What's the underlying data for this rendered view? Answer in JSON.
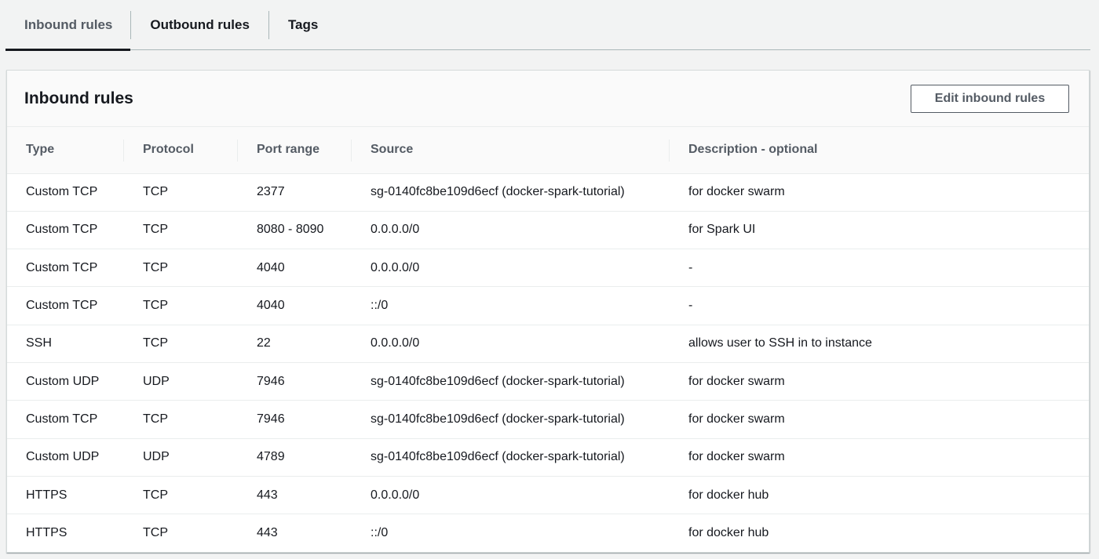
{
  "tabs": [
    {
      "label": "Inbound rules",
      "active": true
    },
    {
      "label": "Outbound rules",
      "active": false
    },
    {
      "label": "Tags",
      "active": false
    }
  ],
  "panel": {
    "title": "Inbound rules",
    "edit_button_label": "Edit inbound rules"
  },
  "table": {
    "columns": [
      "Type",
      "Protocol",
      "Port range",
      "Source",
      "Description - optional"
    ],
    "rows": [
      [
        "Custom TCP",
        "TCP",
        "2377",
        "sg-0140fc8be109d6ecf (docker-spark-tutorial)",
        "for docker swarm"
      ],
      [
        "Custom TCP",
        "TCP",
        "8080 - 8090",
        "0.0.0.0/0",
        "for Spark UI"
      ],
      [
        "Custom TCP",
        "TCP",
        "4040",
        "0.0.0.0/0",
        "-"
      ],
      [
        "Custom TCP",
        "TCP",
        "4040",
        "::/0",
        "-"
      ],
      [
        "SSH",
        "TCP",
        "22",
        "0.0.0.0/0",
        "allows user to SSH in to instance"
      ],
      [
        "Custom UDP",
        "UDP",
        "7946",
        "sg-0140fc8be109d6ecf (docker-spark-tutorial)",
        "for docker swarm"
      ],
      [
        "Custom TCP",
        "TCP",
        "7946",
        "sg-0140fc8be109d6ecf (docker-spark-tutorial)",
        "for docker swarm"
      ],
      [
        "Custom UDP",
        "UDP",
        "4789",
        "sg-0140fc8be109d6ecf (docker-spark-tutorial)",
        "for docker swarm"
      ],
      [
        "HTTPS",
        "TCP",
        "443",
        "0.0.0.0/0",
        "for docker hub"
      ],
      [
        "HTTPS",
        "TCP",
        "443",
        "::/0",
        "for docker hub"
      ]
    ]
  },
  "colors": {
    "background": "#f2f3f3",
    "panel_background": "#ffffff",
    "header_background": "#fafafa",
    "text_primary": "#16191f",
    "text_secondary": "#545b64",
    "divider": "#eaeded"
  }
}
